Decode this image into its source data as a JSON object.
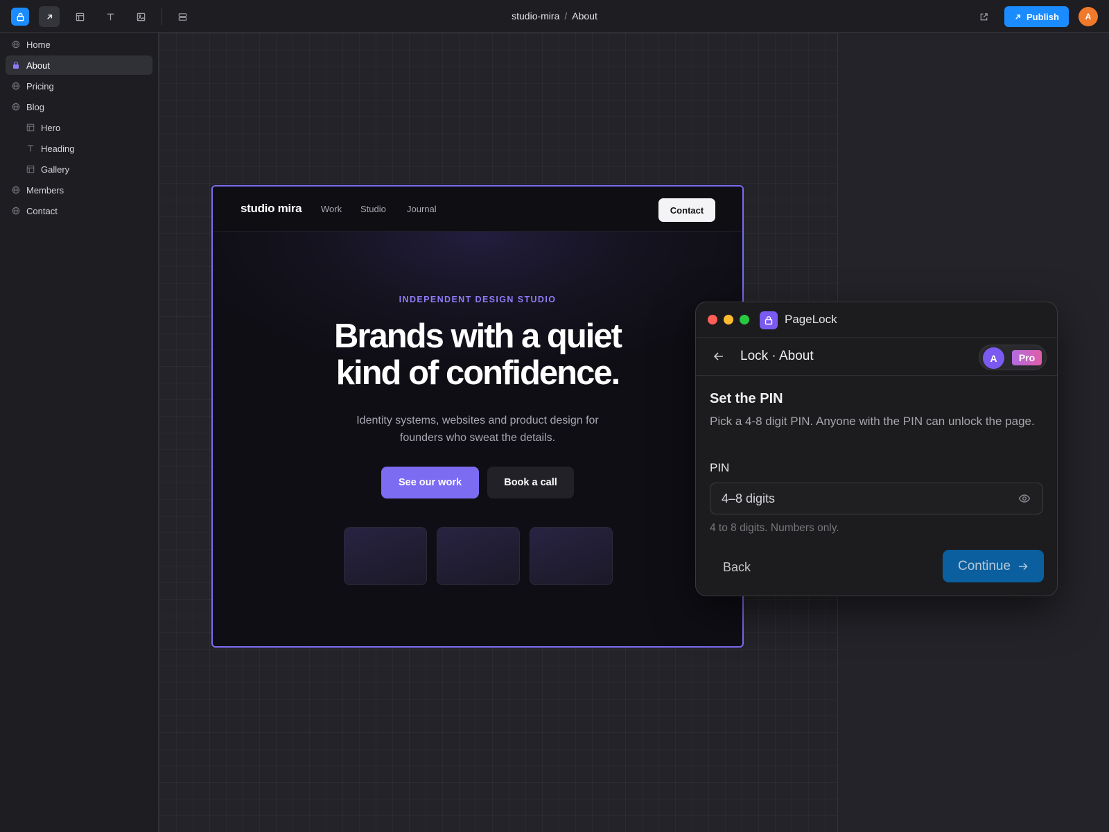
{
  "toolbar": {
    "breadcrumb": {
      "project": "studio-mira",
      "separator": "/",
      "page": "About"
    },
    "publish_label": "Publish",
    "user_initial": "A"
  },
  "sidebar": {
    "items": [
      {
        "label": "Home",
        "icon": "globe-icon"
      },
      {
        "label": "About",
        "icon": "lock-icon",
        "active": true
      },
      {
        "label": "Pricing",
        "icon": "globe-icon"
      },
      {
        "label": "Blog",
        "icon": "globe-icon"
      },
      {
        "label": "Hero",
        "icon": "layout-icon"
      },
      {
        "label": "Heading",
        "icon": "text-icon"
      },
      {
        "label": "Gallery",
        "icon": "layout-icon"
      },
      {
        "label": "Members",
        "icon": "globe-icon"
      },
      {
        "label": "Contact",
        "icon": "globe-icon"
      }
    ]
  },
  "site": {
    "logo": "studio mira",
    "nav": [
      "Work",
      "Studio",
      "Journal"
    ],
    "contact_label": "Contact",
    "eyebrow": "INDEPENDENT DESIGN STUDIO",
    "headline_line1": "Brands with a quiet",
    "headline_line2": "kind of confidence.",
    "subtext": "Identity systems, websites and product design for founders who sweat the details.",
    "cta_primary": "See our work",
    "cta_secondary": "Book a call"
  },
  "dialog": {
    "app_name": "PageLock",
    "title": "Lock · About",
    "account_initial": "A",
    "plan_badge": "Pro",
    "section_title": "Set the PIN",
    "section_desc": "Pick a 4-8 digit PIN. Anyone with the PIN can unlock the page.",
    "field_label": "PIN",
    "pin_placeholder": "4–8 digits",
    "hint": "4 to 8 digits. Numbers only.",
    "back_label": "Back",
    "continue_label": "Continue"
  },
  "colors": {
    "accent_blue": "#1a8cff",
    "accent_purple": "#7c6cf2",
    "traffic_red": "#ff5f57",
    "traffic_yellow": "#febc2e",
    "traffic_green": "#28c840"
  }
}
